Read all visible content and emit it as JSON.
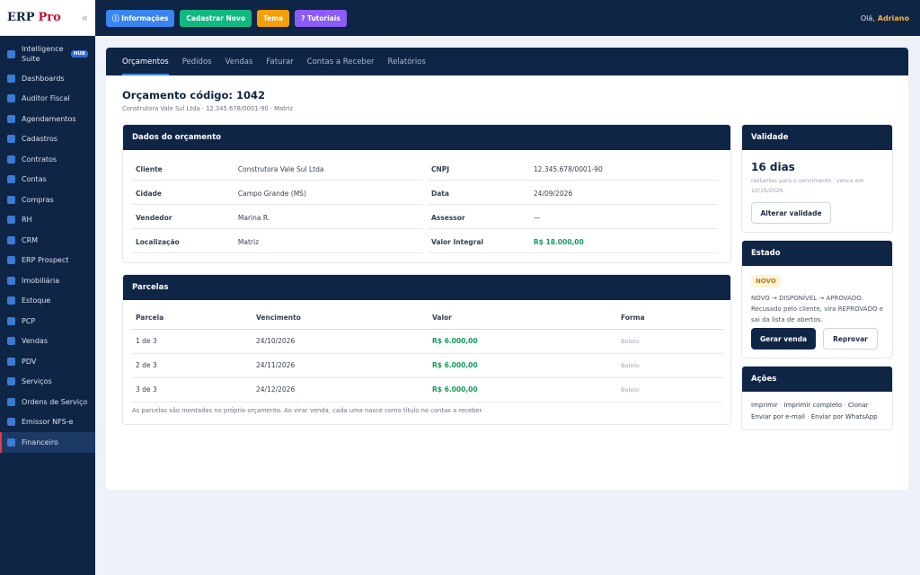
{
  "brand": {
    "name": "ERP",
    "accent": "Pro"
  },
  "sidebar": {
    "items": [
      {
        "label": "Intelligence Suite",
        "badge": "HUB"
      },
      {
        "label": "Dashboards"
      },
      {
        "label": "Auditor Fiscal"
      },
      {
        "label": "Agendamentos"
      },
      {
        "label": "Cadastros"
      },
      {
        "label": "Contratos"
      },
      {
        "label": "Contas"
      },
      {
        "label": "Compras"
      },
      {
        "label": "RH"
      },
      {
        "label": "CRM"
      },
      {
        "label": "ERP Prospect"
      },
      {
        "label": "Imobiliária"
      },
      {
        "label": "Estoque"
      },
      {
        "label": "PCP"
      },
      {
        "label": "Vendas"
      },
      {
        "label": "PDV"
      },
      {
        "label": "Serviços"
      },
      {
        "label": "Ordens de Serviço"
      },
      {
        "label": "Emissor NFS-e"
      },
      {
        "label": "Financeiro"
      }
    ],
    "active": "Financeiro"
  },
  "topbar": {
    "info": "ⓘ Informações",
    "cadastrar": "Cadastrar Novo",
    "tema": "Tema",
    "tutoriais": "? Tutoriais",
    "greeting": "Olá,",
    "user": "Adriano"
  },
  "tabs": [
    "Orçamentos",
    "Pedidos",
    "Vendas",
    "Faturar",
    "Contas a Receber",
    "Relatórios"
  ],
  "active_tab": "Orçamentos",
  "page": {
    "title": "Orçamento código: 1042",
    "subtitle": "Construtora Vale Sul Ltda · 12.345.678/0001-90 · Matriz"
  },
  "dados": {
    "header": "Dados do orçamento",
    "rows": [
      {
        "k1": "Cliente",
        "v1": "Construtora Vale Sul Ltda",
        "k2": "CNPJ",
        "v2": "12.345.678/0001-90"
      },
      {
        "k1": "Cidade",
        "v1": "Campo Grande (MS)",
        "k2": "Data",
        "v2": "24/09/2026"
      },
      {
        "k1": "Vendedor",
        "v1": "Marina R.",
        "k2": "Assessor",
        "v2": "—"
      },
      {
        "k1": "Localização",
        "v1": "Matriz",
        "k2": "Valor Integral",
        "v2": "R$ 18.000,00"
      }
    ]
  },
  "parcelas": {
    "header": "Parcelas",
    "columns": [
      "Parcela",
      "Vencimento",
      "Valor",
      "Forma"
    ],
    "rows": [
      {
        "parcela": "1 de 3",
        "vencimento": "24/10/2026",
        "valor": "R$ 6.000,00",
        "forma": "Boleto"
      },
      {
        "parcela": "2 de 3",
        "vencimento": "24/11/2026",
        "valor": "R$ 6.000,00",
        "forma": "Boleto"
      },
      {
        "parcela": "3 de 3",
        "vencimento": "24/12/2026",
        "valor": "R$ 6.000,00",
        "forma": "Boleto"
      }
    ],
    "note": "As parcelas são montadas no próprio orçamento. Ao virar venda, cada uma nasce como título no contas a receber."
  },
  "validade": {
    "header": "Validade",
    "days": "16 dias",
    "sub": "restantes para o vencimento · vence em 10/10/2026",
    "button": "Alterar validade"
  },
  "estado": {
    "header": "Estado",
    "badge": "NOVO",
    "text": "NOVO → DISPONÍVEL → APROVADO. Recusado pelo cliente, vira REPROVADO e sai da lista de abertos.",
    "primary": "Gerar venda",
    "secondary": "Reprovar"
  },
  "acoes": {
    "header": "Ações",
    "links": [
      "Imprimir",
      "Imprimir completo",
      "Clonar",
      "Enviar por e-mail",
      "Enviar por WhatsApp"
    ]
  },
  "colors": {
    "navy": "#0f2546",
    "info_button": "#3a86f0",
    "cadastrar_button": "#10b981",
    "tema_button": "#f59e0b",
    "tutoriais_button": "#8b5cf6",
    "money": "#0f9d58",
    "accent_red": "#c8102e"
  }
}
